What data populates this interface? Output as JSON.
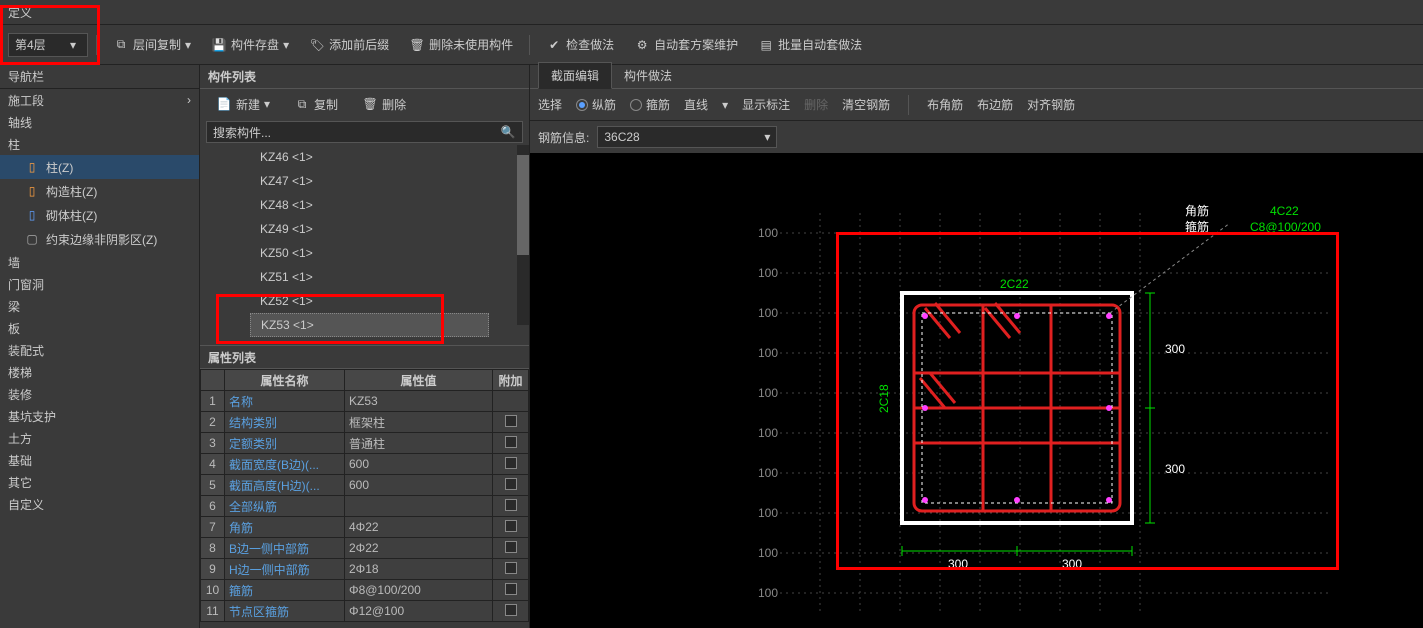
{
  "top": {
    "title": "定义"
  },
  "toolbar": {
    "floor": "第4层",
    "btn_copy": "层间复制",
    "btn_save": "构件存盘",
    "btn_prefix": "添加前后缀",
    "btn_delete_unused": "删除未使用构件",
    "btn_check": "检查做法",
    "btn_auto_maintain": "自动套方案维护",
    "btn_batch": "批量自动套做法"
  },
  "nav": {
    "title": "导航栏",
    "items": [
      "施工段",
      "轴线",
      "柱",
      "墙",
      "门窗洞",
      "梁",
      "板",
      "装配式",
      "楼梯",
      "装修",
      "基坑支护",
      "土方",
      "基础",
      "其它",
      "自定义"
    ],
    "columns": [
      {
        "icon": "col-icon-blue",
        "label": "柱(Z)"
      },
      {
        "icon": "col-icon-orange",
        "label": "构造柱(Z)"
      },
      {
        "icon": "col-icon-blue2",
        "label": "砌体柱(Z)"
      },
      {
        "icon": "col-icon-outline",
        "label": "约束边缘非阴影区(Z)"
      }
    ]
  },
  "members": {
    "title": "构件列表",
    "btn_new": "新建",
    "btn_copy": "复制",
    "btn_delete": "删除",
    "search_placeholder": "搜索构件...",
    "list": [
      "KZ46 <1>",
      "KZ47 <1>",
      "KZ48 <1>",
      "KZ49 <1>",
      "KZ50 <1>",
      "KZ51 <1>",
      "KZ52 <1>",
      "KZ53 <1>"
    ],
    "selected_index": 7
  },
  "props": {
    "title": "属性列表",
    "headers": [
      "",
      "属性名称",
      "属性值",
      "附加"
    ],
    "rows": [
      {
        "i": "1",
        "name": "名称",
        "val": "KZ53",
        "chk": false
      },
      {
        "i": "2",
        "name": "结构类别",
        "val": "框架柱",
        "chk": true
      },
      {
        "i": "3",
        "name": "定额类别",
        "val": "普通柱",
        "chk": true
      },
      {
        "i": "4",
        "name": "截面宽度(B边)(...",
        "val": "600",
        "chk": true
      },
      {
        "i": "5",
        "name": "截面高度(H边)(...",
        "val": "600",
        "chk": true
      },
      {
        "i": "6",
        "name": "全部纵筋",
        "val": "",
        "chk": true
      },
      {
        "i": "7",
        "name": "角筋",
        "val": "4Φ22",
        "chk": true
      },
      {
        "i": "8",
        "name": "B边一侧中部筋",
        "val": "2Φ22",
        "chk": true
      },
      {
        "i": "9",
        "name": "H边一侧中部筋",
        "val": "2Φ18",
        "chk": true
      },
      {
        "i": "10",
        "name": "箍筋",
        "val": "Φ8@100/200",
        "chk": true
      },
      {
        "i": "11",
        "name": "节点区箍筋",
        "val": "Φ12@100",
        "chk": true
      }
    ]
  },
  "section": {
    "tab1": "截面编辑",
    "tab2": "构件做法",
    "select": "选择",
    "long": "纵筋",
    "stirrup": "箍筋",
    "line": "直线",
    "show_labels": "显示标注",
    "delete": "删除",
    "clear": "清空钢筋",
    "corner": "布角筋",
    "edge": "布边筋",
    "align": "对齐钢筋",
    "info_label": "钢筋信息:",
    "info_value": "36C28",
    "annot_corner": "角筋",
    "annot_stirrup": "箍筋",
    "annot_4c22": "4C22",
    "annot_c8": "C8@100/200",
    "top_label": "2C22",
    "left_label": "2C18",
    "dim300": "300",
    "tick": "100"
  }
}
